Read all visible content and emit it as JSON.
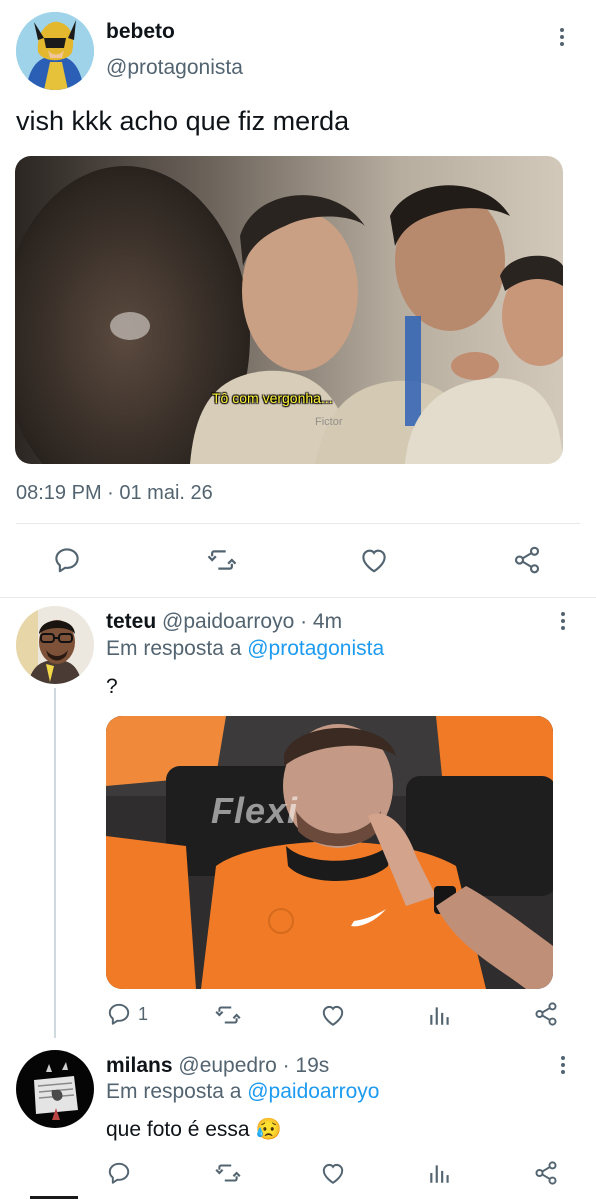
{
  "main_tweet": {
    "display_name": "bebeto",
    "handle": "@protagonista",
    "text": "vish kkk acho que fiz merda",
    "media_caption": "Tô com vergonha...",
    "media_watermark": "Fictor",
    "timestamp": "08:19 PM · 01 mai. 26",
    "actions": [
      "reply-icon",
      "retweet-icon",
      "like-icon",
      "share-icon"
    ]
  },
  "replies": [
    {
      "display_name": "teteu",
      "handle": "@paidoarroyo",
      "time": "· 4m",
      "reply_prefix": "Em resposta a ",
      "reply_to": "@protagonista",
      "text": "?",
      "media_text": "Flexi",
      "reply_count": "1"
    },
    {
      "display_name": "milans",
      "handle": "@eupedro",
      "time": "· 19s",
      "reply_prefix": "Em resposta a ",
      "reply_to": "@paidoarroyo",
      "text": "que foto é essa 😥"
    }
  ],
  "colors": {
    "text": "#0f1419",
    "secondary": "#536471",
    "link": "#1d9bf0",
    "divider": "#e7e9ea",
    "jersey_orange": "#f07a26"
  }
}
